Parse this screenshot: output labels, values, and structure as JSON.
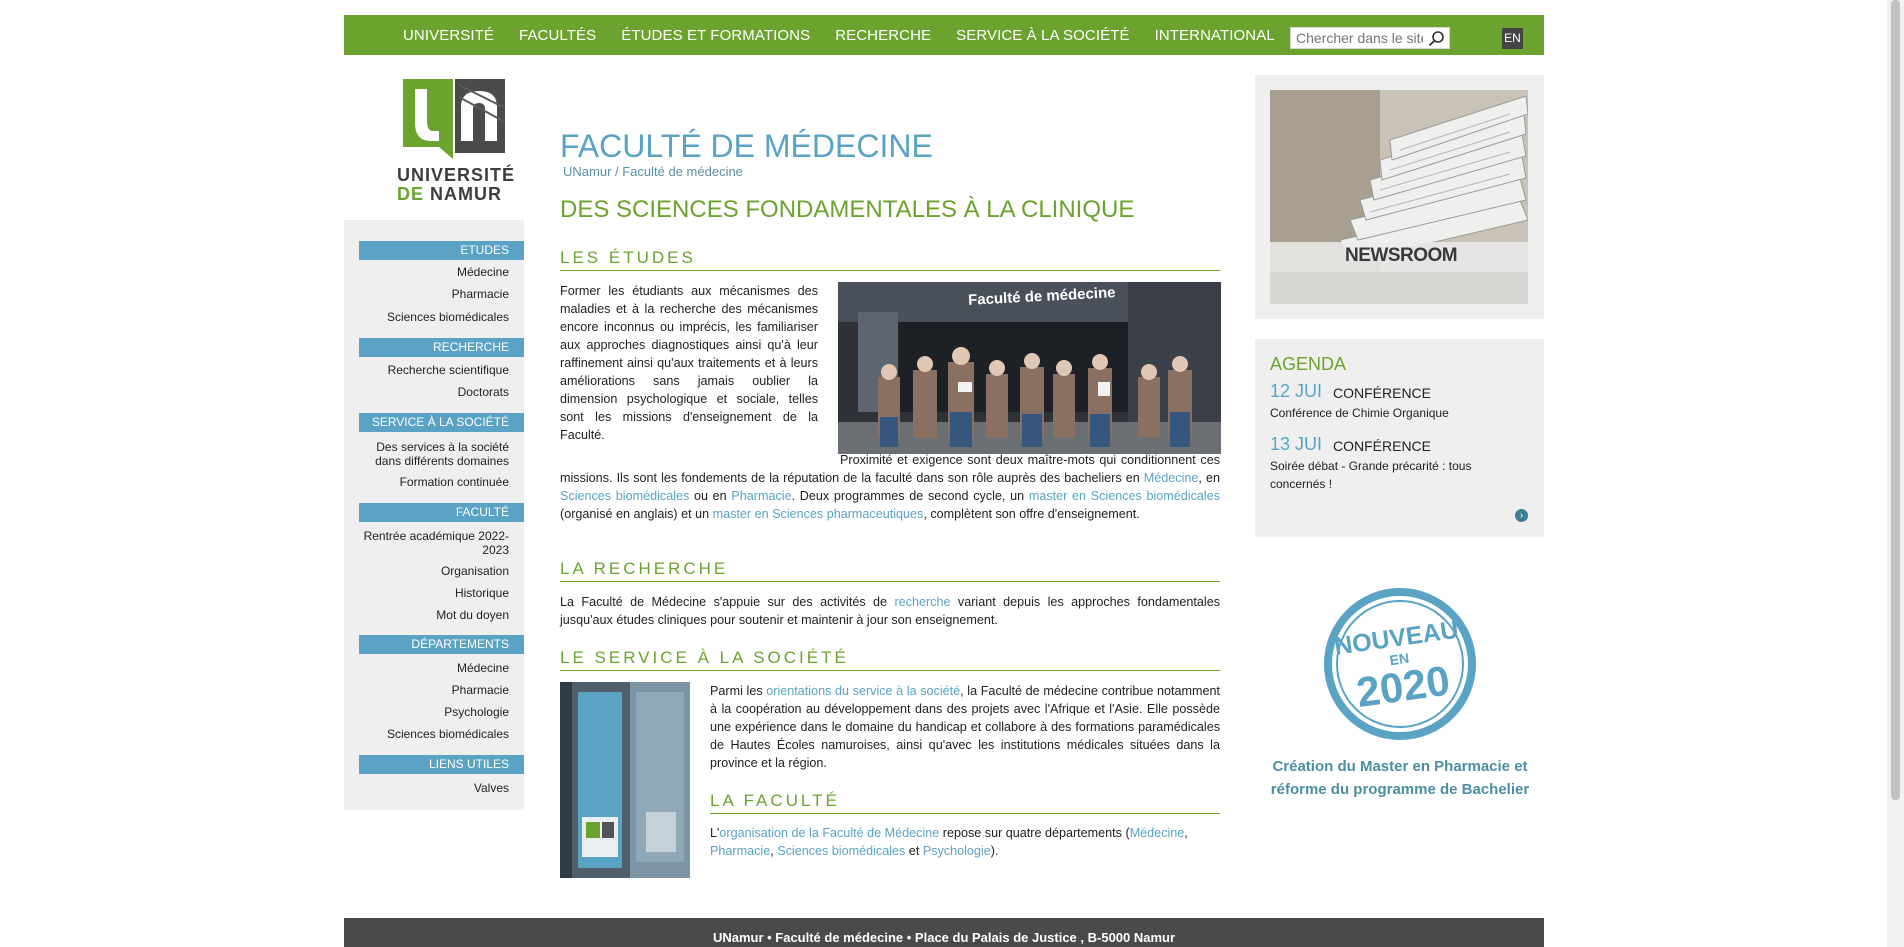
{
  "nav": {
    "items": [
      "UNIVERSITÉ",
      "FACULTÉS",
      "ÉTUDES ET FORMATIONS",
      "RECHERCHE",
      "SERVICE À LA SOCIÉTÉ",
      "INTERNATIONAL"
    ],
    "search_placeholder": "Chercher dans le site",
    "lang": "EN"
  },
  "logo": {
    "line1": "UNIVERSITÉ",
    "line2a": "DE",
    "line2b": "NAMUR"
  },
  "sidebar": {
    "etudes": {
      "heading": "ETUDES",
      "links": [
        "Médecine",
        "Pharmacie",
        "Sciences biomédicales"
      ]
    },
    "recherche": {
      "heading": "RECHERCHE",
      "links": [
        "Recherche scientifique",
        "Doctorats"
      ]
    },
    "service": {
      "heading": "SERVICE À LA SOCIÉTÉ",
      "links": [
        "Des services à la société dans différents domaines",
        "Formation continuée"
      ]
    },
    "faculte": {
      "heading": "FACULTÉ",
      "links": [
        "Rentrée académique 2022-2023",
        "Organisation",
        "Historique",
        "Mot du doyen"
      ]
    },
    "departements": {
      "heading": "DÉPARTEMENTS",
      "links": [
        "Médecine",
        "Pharmacie",
        "Psychologie",
        "Sciences biomédicales"
      ]
    },
    "liens": {
      "heading": "LIENS UTILES",
      "links": [
        "Valves"
      ]
    }
  },
  "main": {
    "title": "FACULTÉ DE MÉDECINE",
    "breadcrumb": "UNamur / Faculté de médecine",
    "subtitle": "DES SCIENCES FONDAMENTALES À LA CLINIQUE",
    "etudes": {
      "heading": "LES ÉTUDES",
      "p1": "Former les étudiants aux mécanismes des maladies et à la recherche des mécanismes encore inconnus ou imprécis, les familiariser aux approches diagnostiques ainsi qu'à leur raffinement ainsi qu'aux traitements et à leurs améliorations sans jamais oublier la dimension psychologique et sociale, telles sont les missions d'enseignement de la Faculté.",
      "p2a": "Proximité et exigence sont deux maître-mots qui conditionnent ces missions. Ils sont les fondements de la réputation de la faculté dans son rôle auprès des bacheliers en ",
      "l1": "Médecine",
      "t1": ", en ",
      "l2": "Sciences biomédicales",
      "t2": " ou en ",
      "l3": "Pharmacie",
      "t3": ". Deux programmes de second cycle, un ",
      "l4": "master en Sciences biomédicales",
      "t4": " (organisé en anglais) et un ",
      "l5": "master en Sciences pharmaceutiques",
      "t5": ", complètent son offre d'enseignement.",
      "photo_sign": "Faculté de médecine"
    },
    "recherche": {
      "heading": "LA RECHERCHE",
      "t1": "La Faculté de Médecine s'appuie sur des activités de ",
      "l1": "recherche",
      "t2": " variant depuis les approches fondamentales jusqu'aux études cliniques pour soutenir et maintenir à jour son enseignement."
    },
    "service": {
      "heading": "LE SERVICE À LA SOCIÉTÉ",
      "t1": "Parmi les ",
      "l1": "orientations du service à la société",
      "t2": ", la Faculté de médecine contribue notamment à la coopération au développement dans des projets avec l'Afrique et l'Asie. Elle possède une expérience dans le domaine du handicap et collabore à des formations paramédicales de Hautes Écoles namuroises, ainsi qu'avec les institutions médicales situées dans la province et la région."
    },
    "faculte": {
      "heading": "LA FACULTÉ",
      "t1": "L'",
      "l1": "organisation de la Faculté de Médecine",
      "t2": " repose sur quatre départements  (",
      "l2": "Médecine",
      "t3": ", ",
      "l3": "Pharmacie",
      "t4": ", ",
      "l4": "Sciences biomédicales",
      "t5": " et ",
      "l5": "Psychologie",
      "t6": ")."
    }
  },
  "right": {
    "newsroom": "NEWSROOM",
    "agenda": {
      "heading": "AGENDA",
      "events": [
        {
          "date": "12 JUI",
          "category": "CONFÉRENCE",
          "title": "Conférence de Chimie Organique"
        },
        {
          "date": "13 JUI",
          "category": "CONFÉRENCE",
          "title": "Soirée débat - Grande précarité : tous concernés !"
        }
      ]
    },
    "stamp": {
      "top": "NOUVEAU",
      "mid": "EN",
      "year": "2020"
    },
    "promo": "Création du Master en Pharmacie et réforme du programme de Bachelier"
  },
  "footer": "UNamur • Faculté de médecine • Place du Palais de Justice , B-5000 Namur",
  "colors": {
    "green": "#6ca32f",
    "blue": "#5aa3c4",
    "footer": "#4a4a4a"
  }
}
